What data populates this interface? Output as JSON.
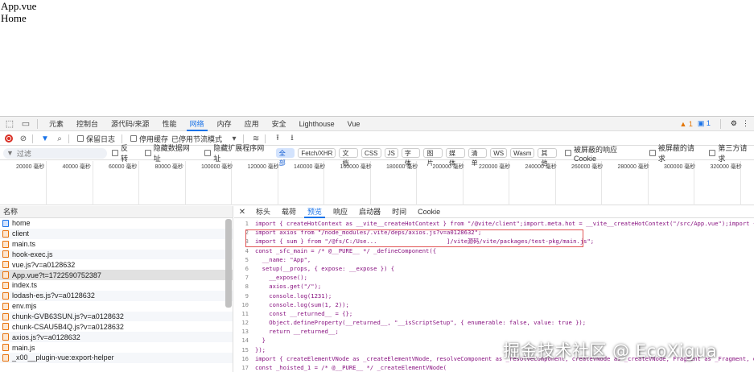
{
  "page": {
    "line1": "App.vue",
    "line2": "Home"
  },
  "devtools_tabs": [
    "元素",
    "控制台",
    "源代码/来源",
    "性能",
    "网络",
    "内存",
    "应用",
    "安全",
    "Lighthouse",
    "Vue"
  ],
  "active_tab": "网络",
  "badges": {
    "warnings": "1",
    "info": "1"
  },
  "toolbar": {
    "preserve_log": "保留日志",
    "disable_cache": "停用缓存",
    "throttle": "已停用节流模式"
  },
  "filterbar": {
    "placeholder": "过滤",
    "invert": "反转",
    "hide_data_urls": "隐藏数据网址",
    "hide_ext_urls": "隐藏扩展程序网址",
    "types": [
      "全部",
      "Fetch/XHR",
      "文档",
      "CSS",
      "JS",
      "字体",
      "图片",
      "媒体",
      "清单",
      "WS",
      "Wasm",
      "其他"
    ],
    "blocked_cookies": "被屏蔽的响应 Cookie",
    "blocked_requests": "被屏蔽的请求",
    "third_party": "第三方请求"
  },
  "timeline_ticks": [
    "20000 毫秒",
    "40000 毫秒",
    "60000 毫秒",
    "80000 毫秒",
    "100000 毫秒",
    "120000 毫秒",
    "140000 毫秒",
    "160000 毫秒",
    "180000 毫秒",
    "200000 毫秒",
    "220000 毫秒",
    "240000 毫秒",
    "260000 毫秒",
    "280000 毫秒",
    "300000 毫秒",
    "320000 毫秒"
  ],
  "requests_header": "名称",
  "requests": [
    {
      "name": "home",
      "type": "doc"
    },
    {
      "name": "client",
      "type": "js"
    },
    {
      "name": "main.ts",
      "type": "js"
    },
    {
      "name": "hook-exec.js",
      "type": "js"
    },
    {
      "name": "vue.js?v=a0128632",
      "type": "js"
    },
    {
      "name": "App.vue?t=1722590752387",
      "type": "js",
      "selected": true
    },
    {
      "name": "index.ts",
      "type": "js"
    },
    {
      "name": "lodash-es.js?v=a0128632",
      "type": "js"
    },
    {
      "name": "env.mjs",
      "type": "js"
    },
    {
      "name": "chunk-GVB63SUN.js?v=a0128632",
      "type": "js"
    },
    {
      "name": "chunk-CSAU5B4Q.js?v=a0128632",
      "type": "js"
    },
    {
      "name": "axios.js?v=a0128632",
      "type": "js"
    },
    {
      "name": "main.js",
      "type": "js"
    },
    {
      "name": "_x00__plugin-vue:export-helper",
      "type": "js"
    }
  ],
  "preview_tabs": [
    "标头",
    "载荷",
    "预览",
    "响应",
    "启动器",
    "时间",
    "Cookie"
  ],
  "active_preview_tab": "预览",
  "code_lines": [
    {
      "n": "1",
      "t": "import { createHotContext as __vite__createHotContext } from \"/@vite/client\";import.meta.hot = __vite__createHotContext(\"/src/App.vue\");import { define"
    },
    {
      "n": "2",
      "t": "import axios from \"/node_modules/.vite/deps/axios.js?v=a0128632\";"
    },
    {
      "n": "3",
      "t": "import { sum } from \"/@fs/C:/Use...                    ]/vite源码/vite/packages/test-pkg/main.js\";"
    },
    {
      "n": "4",
      "t": "const _sfc_main = /* @__PURE__ */ _defineComponent({"
    },
    {
      "n": "5",
      "t": "  __name: \"App\","
    },
    {
      "n": "6",
      "t": "  setup(__props, { expose: __expose }) {"
    },
    {
      "n": "7",
      "t": "    __expose();"
    },
    {
      "n": "8",
      "t": "    axios.get(\"/\");"
    },
    {
      "n": "9",
      "t": "    console.log(1231);"
    },
    {
      "n": "10",
      "t": "    console.log(sum(1, 2));"
    },
    {
      "n": "11",
      "t": "    const __returned__ = {};"
    },
    {
      "n": "12",
      "t": "    Object.defineProperty(__returned__, \"__isScriptSetup\", { enumerable: false, value: true });"
    },
    {
      "n": "13",
      "t": "    return __returned__;"
    },
    {
      "n": "14",
      "t": "  }"
    },
    {
      "n": "15",
      "t": "});"
    },
    {
      "n": "16",
      "t": "import { createElementVNode as _createElementVNode, resolveComponent as _resolveComponent, createVNode as _createVNode, Fragment as _Fragment, openBloc"
    },
    {
      "n": "17",
      "t": "const _hoisted_1 = /* @__PURE__ */ _createElementVNode("
    }
  ],
  "watermark": "掘金技术社区 @ EcoXigua"
}
